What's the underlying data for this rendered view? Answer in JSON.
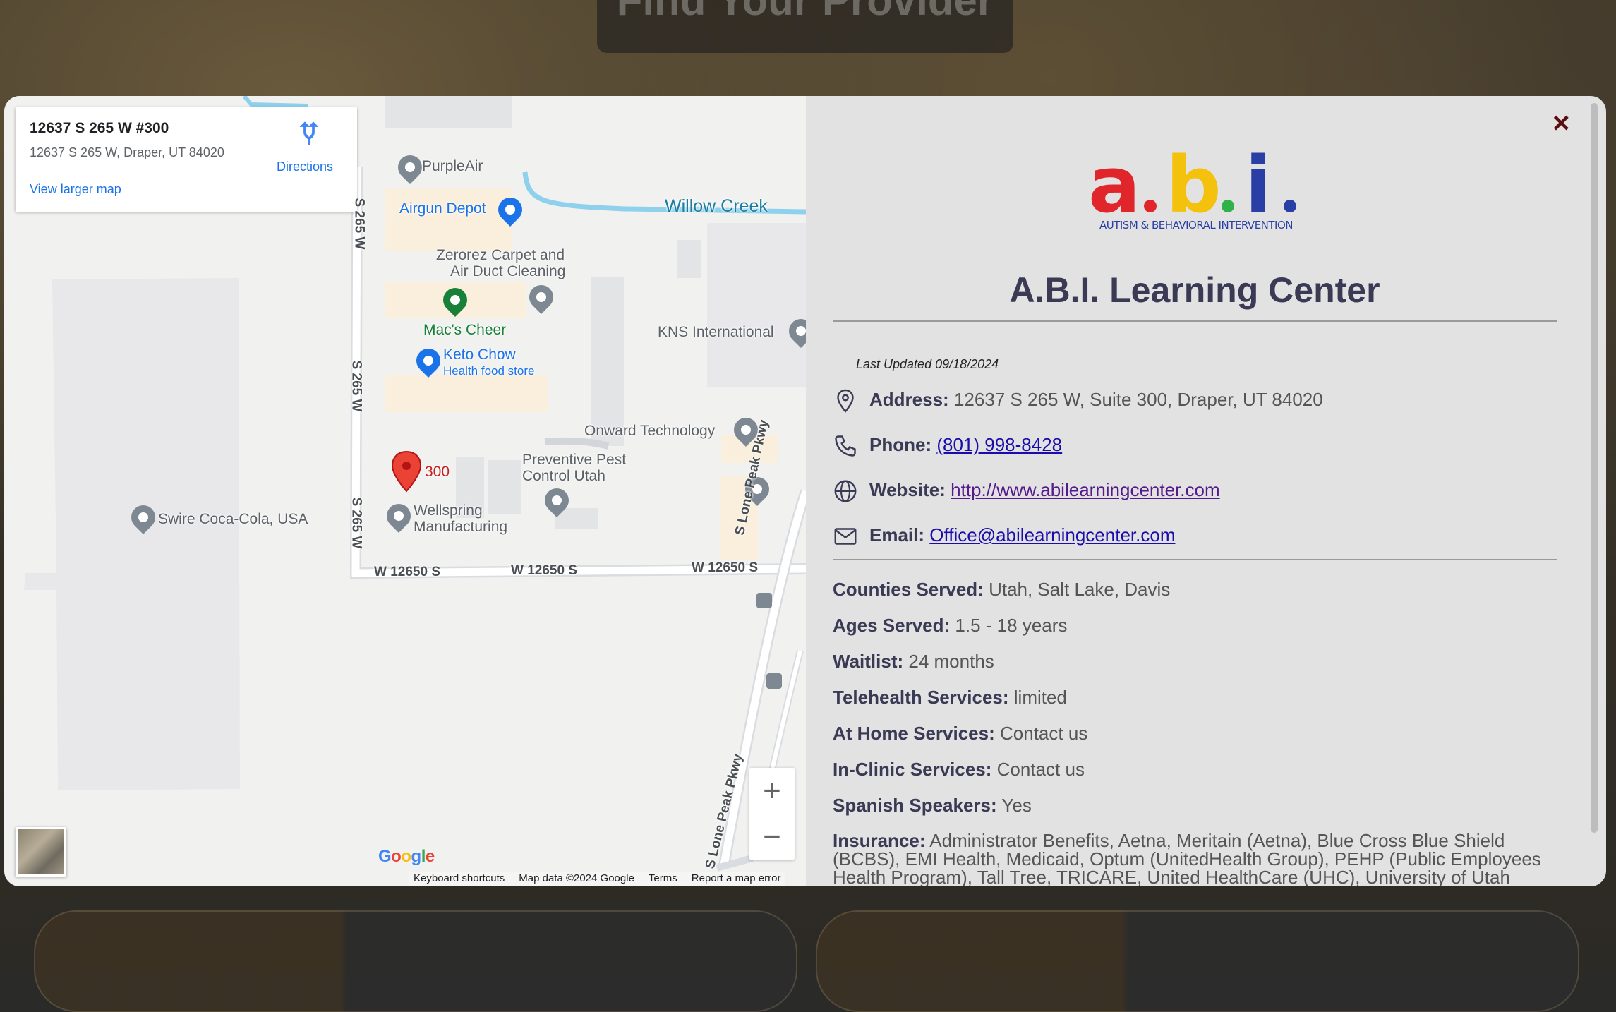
{
  "background": {
    "title": "Find Your Provider"
  },
  "map": {
    "info_card": {
      "title": "12637 S 265 W #300",
      "address": "12637 S 265 W, Draper, UT 84020",
      "directions": "Directions",
      "view_larger": "View larger map"
    },
    "labels": {
      "purpleair": "PurpleAir",
      "airgun": "Airgun Depot",
      "willow": "Willow Creek",
      "zerorez1": "Zerorez Carpet and",
      "zerorez2": "Air Duct Cleaning",
      "macs": "Mac's Cheer",
      "kns": "KNS International",
      "keto1": "Keto Chow",
      "keto2": "Health food store",
      "onward": "Onward Technology",
      "pin300": "300",
      "pest1": "Preventive Pest",
      "pest2": "Control Utah",
      "wellspring1": "Wellspring",
      "wellspring2": "Manufacturing",
      "swire": "Swire Coca-Cola, USA",
      "road_265_a": "S 265 W",
      "road_265_b": "S 265 W",
      "road_265_c": "S 265 W",
      "road_12650_a": "W 12650 S",
      "road_12650_b": "W 12650 S",
      "road_12650_c": "W 12650 S",
      "lone_peak": "S Lone Peak Pkwy",
      "lone_peak2": "S Lone Peak Pkwy"
    },
    "zoom_in": "+",
    "zoom_out": "−",
    "google": "Google",
    "footer": {
      "shortcuts": "Keyboard shortcuts",
      "data": "Map data ©2024 Google",
      "terms": "Terms",
      "report": "Report a map error"
    }
  },
  "provider": {
    "close": "×",
    "logo_letters": [
      "a",
      "b",
      "i"
    ],
    "logo_tagline": "AUTISM & BEHAVIORAL INTERVENTION",
    "name": "A.B.I. Learning Center",
    "last_updated": "Last Updated 09/18/2024",
    "address_label": "Address:",
    "address": "12637 S 265 W, Suite 300, Draper, UT 84020",
    "phone_label": "Phone:",
    "phone": "(801) 998-8428",
    "website_label": "Website:",
    "website": "http://www.abilearningcenter.com",
    "email_label": "Email:",
    "email": "Office@abilearningcenter.com",
    "counties_label": "Counties Served:",
    "counties": "Utah, Salt Lake, Davis",
    "ages_label": "Ages Served:",
    "ages": "1.5 - 18 years",
    "waitlist_label": "Waitlist:",
    "waitlist": "24 months",
    "telehealth_label": "Telehealth Services:",
    "telehealth": "limited",
    "home_label": "At Home Services:",
    "home": "Contact us",
    "clinic_label": "In-Clinic Services:",
    "clinic": "Contact us",
    "spanish_label": "Spanish Speakers:",
    "spanish": "Yes",
    "insurance_label": "Insurance:",
    "insurance": "Administrator Benefits, Aetna, Meritain (Aetna), Blue Cross Blue Shield (BCBS), EMI Health, Medicaid, Optum (UnitedHealth Group), PEHP (Public Employees Health Program), Tall Tree, TRICARE, United HealthCare (UHC), University of Utah"
  },
  "colors": {
    "logo_a": "#e0262b",
    "logo_b": "#f4c20d",
    "logo_i": "#2a3fa5",
    "heading": "#3b3a55",
    "link": "#1a0dab"
  }
}
